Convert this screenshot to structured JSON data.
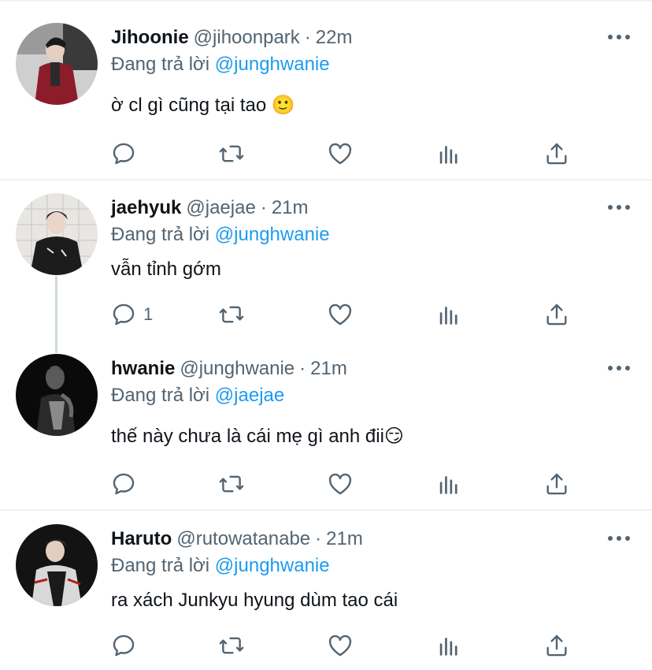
{
  "reply_prefix": "Đang trả lời",
  "dot": "·",
  "tweets": [
    {
      "name": "Jihoonie",
      "handle": "@jihoonpark",
      "time": "22m",
      "reply_to": "@junghwanie",
      "text": "ờ cl gì cũng tại tao 🙂",
      "reply_count": "",
      "avatar_colors": [
        "#2b2b2b",
        "#8c1c2a"
      ]
    },
    {
      "name": "jaehyuk",
      "handle": "@jaejae",
      "time": "21m",
      "reply_to": "@junghwanie",
      "text": "vẫn tỉnh gớm",
      "reply_count": "1",
      "avatar_colors": [
        "#e8e6e2",
        "#1c1c1c"
      ]
    },
    {
      "name": "hwanie",
      "handle": "@junghwanie",
      "time": "21m",
      "reply_to": "@jaejae",
      "text": "thế này chưa là cái mẹ gì anh đii😏",
      "reply_count": "",
      "avatar_colors": [
        "#0a0a0a",
        "#6b6b6b"
      ]
    },
    {
      "name": "Haruto",
      "handle": "@rutowatanabe",
      "time": "21m",
      "reply_to": "@junghwanie",
      "text": "ra xách Junkyu hyung dùm tao cái",
      "reply_count": "",
      "avatar_colors": [
        "#131313",
        "#d8d8d8"
      ]
    }
  ],
  "icons": [
    "reply-icon",
    "retweet-icon",
    "like-icon",
    "analytics-icon",
    "share-icon",
    "more-icon"
  ],
  "colors": {
    "accent": "#1d9bf0",
    "muted": "#536471",
    "text": "#0f1419",
    "divider": "#eff3f4"
  }
}
